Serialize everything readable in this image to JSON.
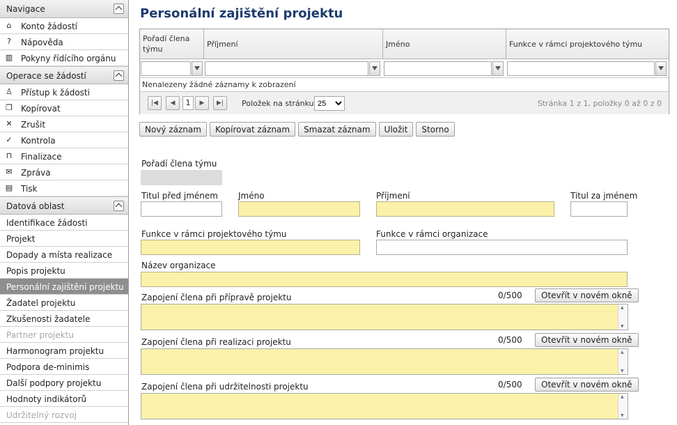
{
  "sidebar": {
    "nav_title": "Navigace",
    "nav_items": [
      {
        "label": "Konto žádostí",
        "icon": "home-icon"
      },
      {
        "label": "Nápověda",
        "icon": "help-icon"
      },
      {
        "label": "Pokyny řídícího orgánu",
        "icon": "book-icon"
      }
    ],
    "ops_title": "Operace se žádostí",
    "ops_items": [
      {
        "label": "Přístup k žádosti",
        "icon": "user-icon"
      },
      {
        "label": "Kopírovat",
        "icon": "copy-icon"
      },
      {
        "label": "Zrušit",
        "icon": "cross-icon"
      },
      {
        "label": "Kontrola",
        "icon": "check-icon"
      },
      {
        "label": "Finalizace",
        "icon": "lock-icon"
      },
      {
        "label": "Zpráva",
        "icon": "mail-icon"
      },
      {
        "label": "Tisk",
        "icon": "print-icon"
      }
    ],
    "data_title": "Datová oblast",
    "data_items": [
      {
        "label": "Identifikace žádosti"
      },
      {
        "label": "Projekt"
      },
      {
        "label": "Dopady a místa realizace"
      },
      {
        "label": "Popis projektu"
      },
      {
        "label": "Personální zajištění projektu"
      },
      {
        "label": "Žadatel projektu"
      },
      {
        "label": "Zkušenosti žadatele"
      },
      {
        "label": "Partner projektu"
      },
      {
        "label": "Harmonogram projektu"
      },
      {
        "label": "Podpora de-minimis"
      },
      {
        "label": "Další podpory projektu"
      },
      {
        "label": "Hodnoty indikátorů"
      },
      {
        "label": "Udržitelný rozvoj"
      }
    ]
  },
  "page": {
    "title": "Personální zajištění projektu"
  },
  "grid": {
    "columns": [
      "Pořadí člena týmu",
      "Příjmení",
      "Jméno",
      "Funkce v rámci projektového týmu"
    ],
    "empty_text": "Nenalezeny žádné záznamy k zobrazení",
    "current_page": "1",
    "page_size_label": "Položek na stránku",
    "page_size": "25",
    "page_info": "Stránka 1 z 1, položky 0 až 0 z 0"
  },
  "toolbar": {
    "new": "Nový záznam",
    "copy": "Kopírovat záznam",
    "delete": "Smazat záznam",
    "save": "Uložit",
    "cancel": "Storno"
  },
  "form": {
    "order_label": "Pořadí člena týmu",
    "title_before_label": "Titul před jménem",
    "first_name_label": "Jméno",
    "surname_label": "Příjmení",
    "title_after_label": "Titul za jménem",
    "project_function_label": "Funkce v rámci projektového týmu",
    "org_function_label": "Funkce v rámci organizace",
    "org_name_label": "Název organizace",
    "prep_label": "Zapojení člena při přípravě projektu",
    "prep_counter": "0/500",
    "impl_label": "Zapojení člena při realizaci projektu",
    "impl_counter": "0/500",
    "sust_label": "Zapojení člena při udržitelnosti projektu",
    "sust_counter": "0/500",
    "open_window": "Otevřít v novém okně"
  }
}
